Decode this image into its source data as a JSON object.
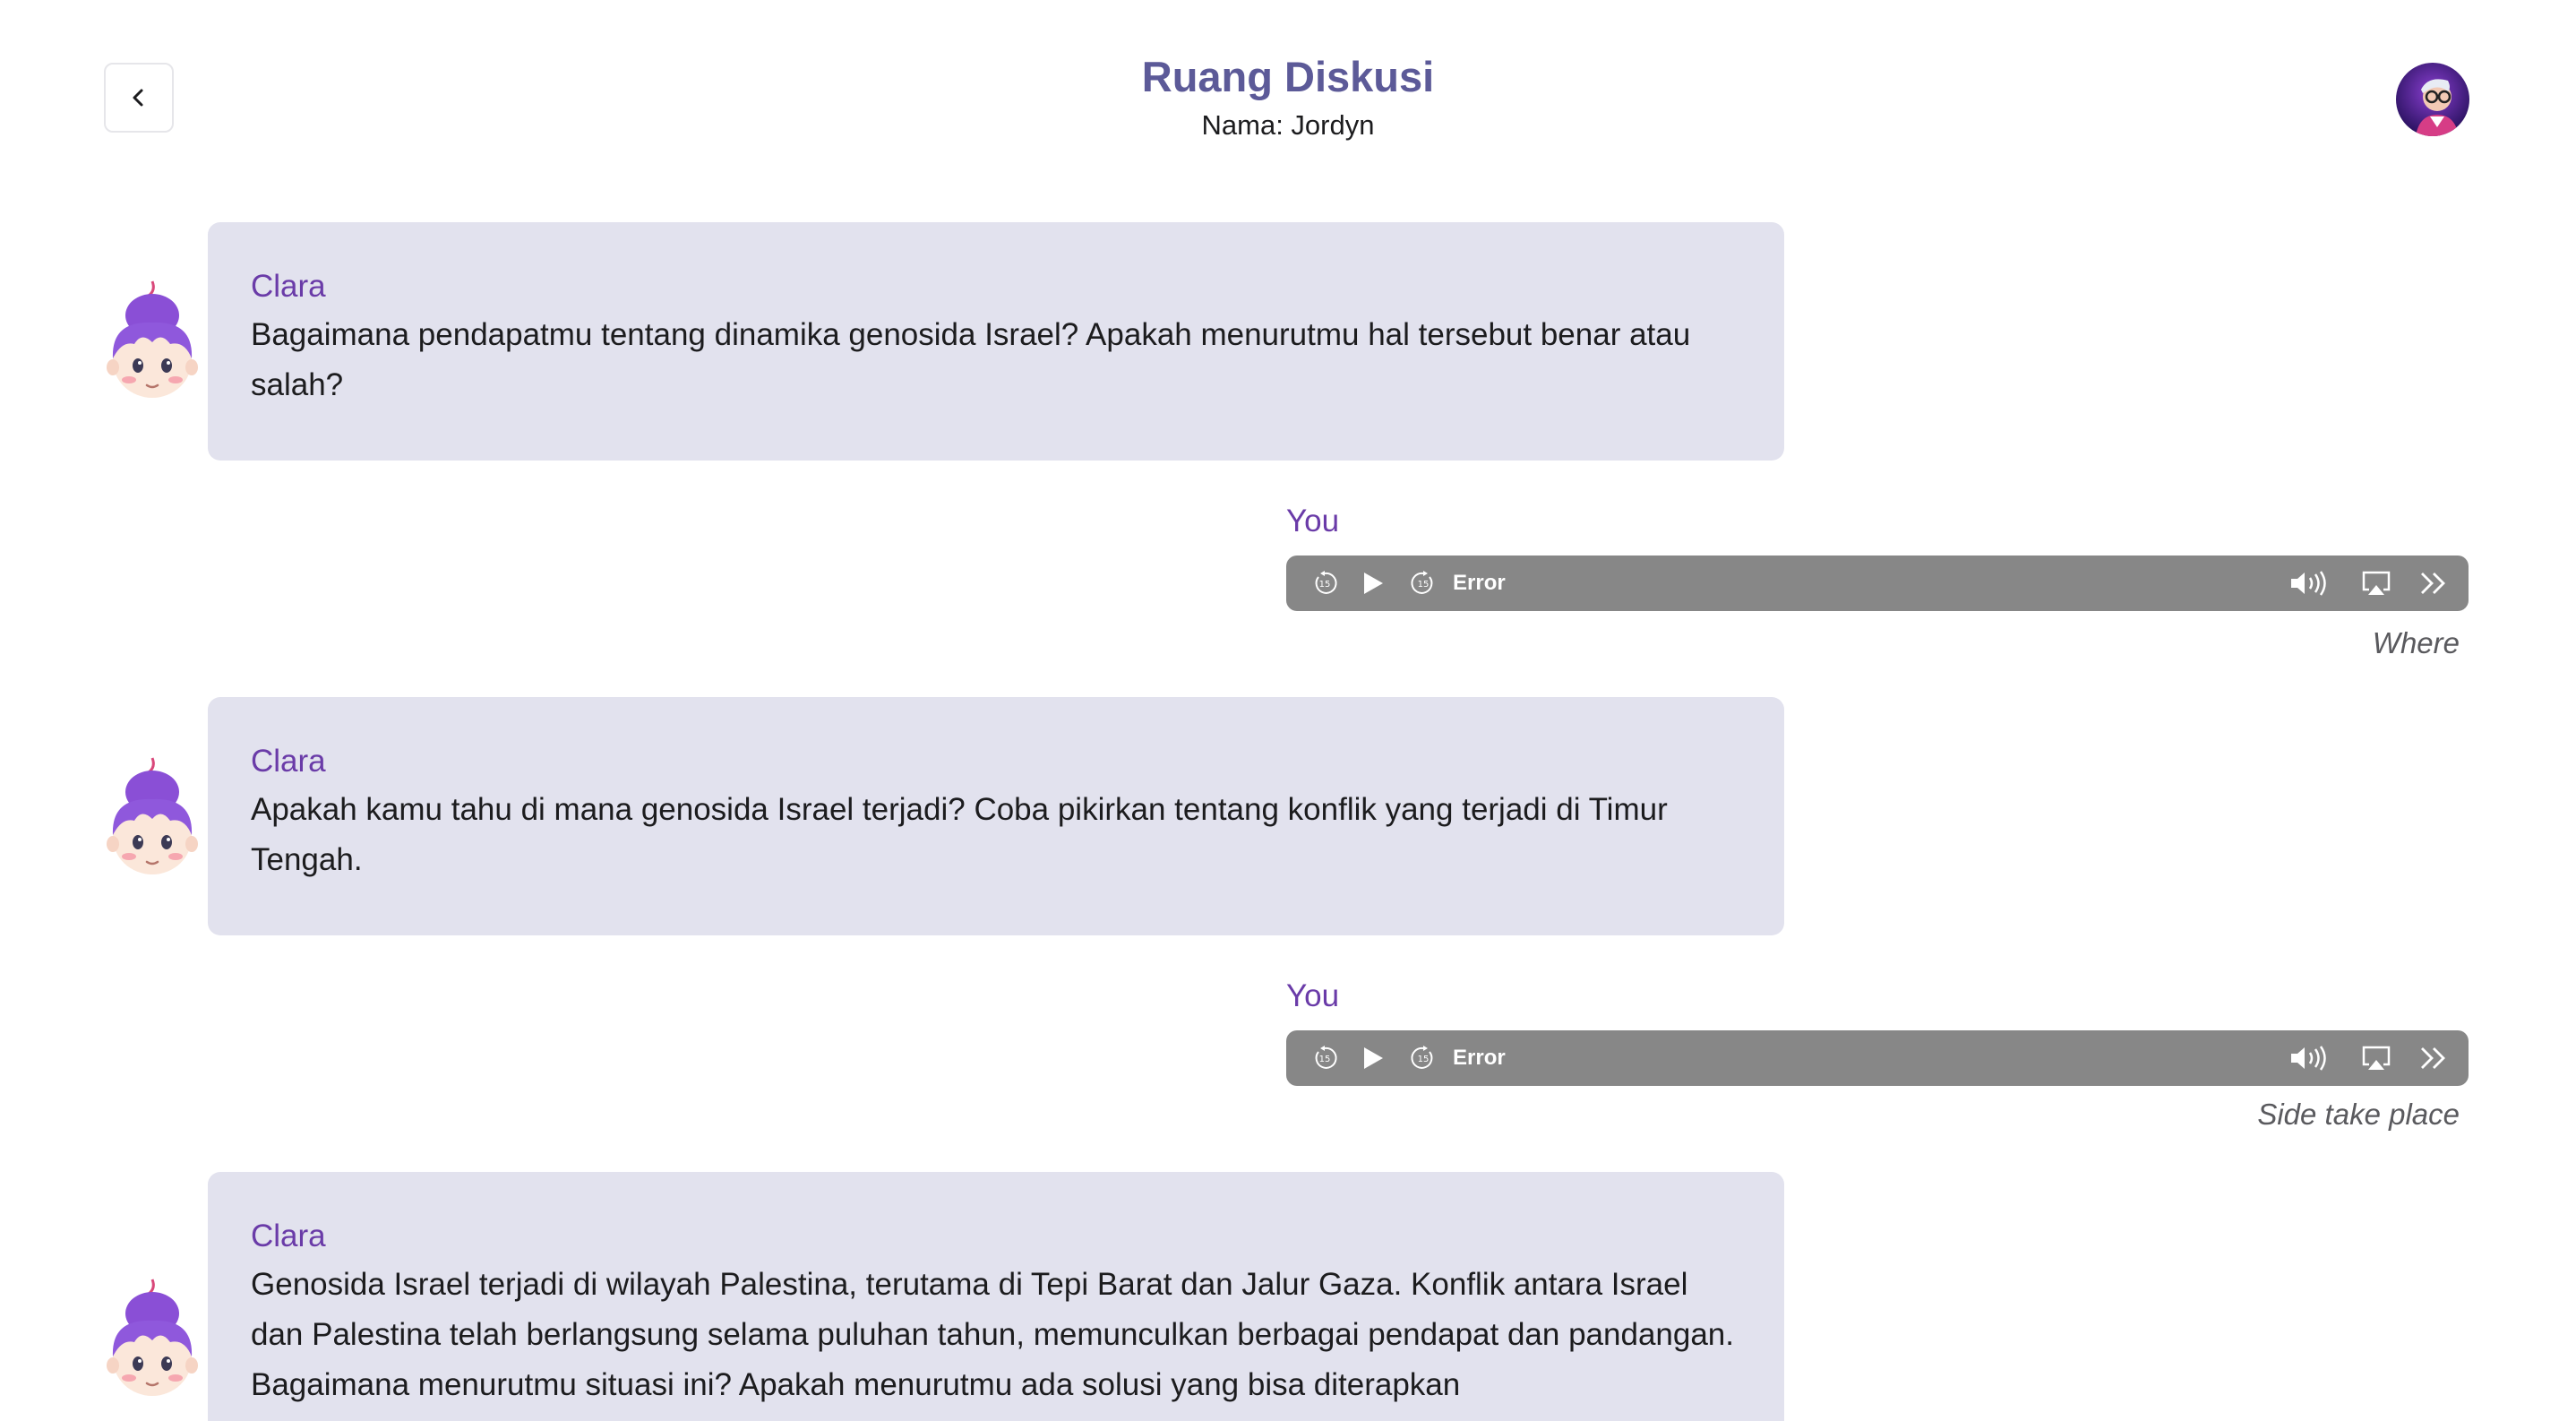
{
  "header": {
    "title": "Ruang Diskusi",
    "subtitle": "Nama: Jordyn"
  },
  "colors": {
    "accent": "#6a3ba8",
    "title": "#5c5a98",
    "bot_bubble": "#e2e2ee",
    "player_bg": "#878787"
  },
  "messages": [
    {
      "sender": "Clara",
      "text": "Bagaimana pendapatmu tentang dinamika genosida Israel? Apakah menurutmu hal tersebut benar atau salah?"
    },
    {
      "sender": "You",
      "audio_status": "Error",
      "caption": "Where"
    },
    {
      "sender": "Clara",
      "text": "Apakah kamu tahu di mana genosida Israel terjadi? Coba pikirkan tentang konflik yang terjadi di Timur Tengah."
    },
    {
      "sender": "You",
      "audio_status": "Error",
      "caption": "Side take place"
    },
    {
      "sender": "Clara",
      "text": "Genosida Israel terjadi di wilayah Palestina, terutama di Tepi Barat dan Jalur Gaza. Konflik antara Israel dan Palestina telah berlangsung selama puluhan tahun, memunculkan berbagai pendapat dan pandangan. Bagaimana menurutmu situasi ini? Apakah menurutmu ada solusi yang bisa diterapkan"
    }
  ],
  "icons": {
    "back": "chevron-left-icon",
    "skip_back": "skip-back-15-icon",
    "play": "play-icon",
    "skip_forward": "skip-forward-15-icon",
    "volume": "volume-icon",
    "airplay": "airplay-icon",
    "more": "chevrons-right-icon"
  }
}
